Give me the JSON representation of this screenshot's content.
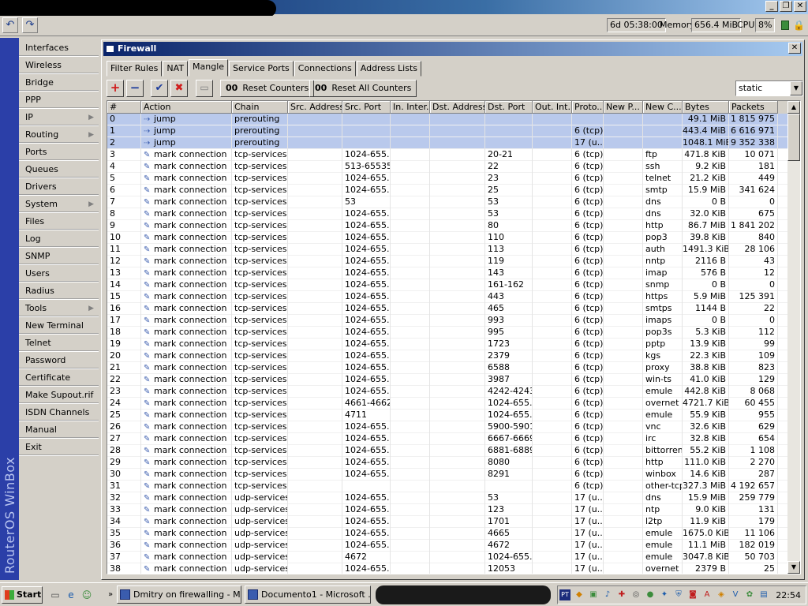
{
  "window": {
    "title": "",
    "controls": [
      "_",
      "❐",
      "✕"
    ]
  },
  "toolbar": {
    "uptime": "6d 05:38:00",
    "memory_label": "Memory:",
    "memory_value": "656.4 MiB",
    "cpu_label": "CPU:",
    "cpu_value": "8%"
  },
  "brand": "RouterOS WinBox",
  "sidebar": [
    {
      "label": "Interfaces"
    },
    {
      "label": "Wireless"
    },
    {
      "label": "Bridge"
    },
    {
      "label": "PPP"
    },
    {
      "label": "IP",
      "arrow": "▶"
    },
    {
      "label": "Routing",
      "arrow": "▶"
    },
    {
      "label": "Ports"
    },
    {
      "label": "Queues"
    },
    {
      "label": "Drivers"
    },
    {
      "label": "System",
      "arrow": "▶"
    },
    {
      "label": "Files"
    },
    {
      "label": "Log"
    },
    {
      "label": "SNMP"
    },
    {
      "label": "Users"
    },
    {
      "label": "Radius"
    },
    {
      "label": "Tools",
      "arrow": "▶"
    },
    {
      "label": "New Terminal"
    },
    {
      "label": "Telnet"
    },
    {
      "label": "Password"
    },
    {
      "label": "Certificate"
    },
    {
      "label": "Make Supout.rif"
    },
    {
      "label": "ISDN Channels"
    },
    {
      "label": "Manual"
    },
    {
      "label": "Exit"
    }
  ],
  "firewall": {
    "title": "Firewall",
    "tabs": [
      "Filter Rules",
      "NAT",
      "Mangle",
      "Service Ports",
      "Connections",
      "Address Lists"
    ],
    "active_tab": "Mangle",
    "buttons": {
      "add": "+",
      "remove": "−",
      "enable": "✔",
      "disable": "✖",
      "comment": "▭",
      "reset_counters": "Reset Counters",
      "reset_all_counters": "Reset All Counters",
      "counter_prefix": "00"
    },
    "filter_value": "static",
    "columns": [
      "#",
      "Action",
      "Chain",
      "Src. Address",
      "Src. Port",
      "In. Inter...",
      "Dst. Address",
      "Dst. Port",
      "Out. Int...",
      "Proto...",
      "New P...",
      "New C...",
      "Bytes",
      "Packets"
    ],
    "rows": [
      {
        "n": "0",
        "action": "jump",
        "icon": "jump",
        "chain": "prerouting",
        "src_port": "",
        "dst_port": "",
        "proto": "",
        "new_c": "",
        "bytes": "49.1 MiB",
        "packets": "1 815 975",
        "sel": true
      },
      {
        "n": "1",
        "action": "jump",
        "icon": "jump",
        "chain": "prerouting",
        "src_port": "",
        "dst_port": "",
        "proto": "6 (tcp)",
        "new_c": "",
        "bytes": "443.4 MiB",
        "packets": "6 616 971",
        "sel": true
      },
      {
        "n": "2",
        "action": "jump",
        "icon": "jump",
        "chain": "prerouting",
        "src_port": "",
        "dst_port": "",
        "proto": "17 (u...",
        "new_c": "",
        "bytes": "1048.1 MiB",
        "packets": "9 352 338",
        "sel": true
      },
      {
        "n": "3",
        "action": "mark connection",
        "icon": "mark",
        "chain": "tcp-services",
        "src_port": "1024-655...",
        "dst_port": "20-21",
        "proto": "6 (tcp)",
        "new_c": "ftp",
        "bytes": "471.8 KiB",
        "packets": "10 071"
      },
      {
        "n": "4",
        "action": "mark connection",
        "icon": "mark",
        "chain": "tcp-services",
        "src_port": "513-65535",
        "dst_port": "22",
        "proto": "6 (tcp)",
        "new_c": "ssh",
        "bytes": "9.2 KiB",
        "packets": "181"
      },
      {
        "n": "5",
        "action": "mark connection",
        "icon": "mark",
        "chain": "tcp-services",
        "src_port": "1024-655...",
        "dst_port": "23",
        "proto": "6 (tcp)",
        "new_c": "telnet",
        "bytes": "21.2 KiB",
        "packets": "449"
      },
      {
        "n": "6",
        "action": "mark connection",
        "icon": "mark",
        "chain": "tcp-services",
        "src_port": "1024-655...",
        "dst_port": "25",
        "proto": "6 (tcp)",
        "new_c": "smtp",
        "bytes": "15.9 MiB",
        "packets": "341 624"
      },
      {
        "n": "7",
        "action": "mark connection",
        "icon": "mark",
        "chain": "tcp-services",
        "src_port": "53",
        "dst_port": "53",
        "proto": "6 (tcp)",
        "new_c": "dns",
        "bytes": "0 B",
        "packets": "0"
      },
      {
        "n": "8",
        "action": "mark connection",
        "icon": "mark",
        "chain": "tcp-services",
        "src_port": "1024-655...",
        "dst_port": "53",
        "proto": "6 (tcp)",
        "new_c": "dns",
        "bytes": "32.0 KiB",
        "packets": "675"
      },
      {
        "n": "9",
        "action": "mark connection",
        "icon": "mark",
        "chain": "tcp-services",
        "src_port": "1024-655...",
        "dst_port": "80",
        "proto": "6 (tcp)",
        "new_c": "http",
        "bytes": "86.7 MiB",
        "packets": "1 841 202"
      },
      {
        "n": "10",
        "action": "mark connection",
        "icon": "mark",
        "chain": "tcp-services",
        "src_port": "1024-655...",
        "dst_port": "110",
        "proto": "6 (tcp)",
        "new_c": "pop3",
        "bytes": "39.8 KiB",
        "packets": "840"
      },
      {
        "n": "11",
        "action": "mark connection",
        "icon": "mark",
        "chain": "tcp-services",
        "src_port": "1024-655...",
        "dst_port": "113",
        "proto": "6 (tcp)",
        "new_c": "auth",
        "bytes": "1491.3 KiB",
        "packets": "28 106"
      },
      {
        "n": "12",
        "action": "mark connection",
        "icon": "mark",
        "chain": "tcp-services",
        "src_port": "1024-655...",
        "dst_port": "119",
        "proto": "6 (tcp)",
        "new_c": "nntp",
        "bytes": "2116 B",
        "packets": "43"
      },
      {
        "n": "13",
        "action": "mark connection",
        "icon": "mark",
        "chain": "tcp-services",
        "src_port": "1024-655...",
        "dst_port": "143",
        "proto": "6 (tcp)",
        "new_c": "imap",
        "bytes": "576 B",
        "packets": "12"
      },
      {
        "n": "14",
        "action": "mark connection",
        "icon": "mark",
        "chain": "tcp-services",
        "src_port": "1024-655...",
        "dst_port": "161-162",
        "proto": "6 (tcp)",
        "new_c": "snmp",
        "bytes": "0 B",
        "packets": "0"
      },
      {
        "n": "15",
        "action": "mark connection",
        "icon": "mark",
        "chain": "tcp-services",
        "src_port": "1024-655...",
        "dst_port": "443",
        "proto": "6 (tcp)",
        "new_c": "https",
        "bytes": "5.9 MiB",
        "packets": "125 391"
      },
      {
        "n": "16",
        "action": "mark connection",
        "icon": "mark",
        "chain": "tcp-services",
        "src_port": "1024-655...",
        "dst_port": "465",
        "proto": "6 (tcp)",
        "new_c": "smtps",
        "bytes": "1144 B",
        "packets": "22"
      },
      {
        "n": "17",
        "action": "mark connection",
        "icon": "mark",
        "chain": "tcp-services",
        "src_port": "1024-655...",
        "dst_port": "993",
        "proto": "6 (tcp)",
        "new_c": "imaps",
        "bytes": "0 B",
        "packets": "0"
      },
      {
        "n": "18",
        "action": "mark connection",
        "icon": "mark",
        "chain": "tcp-services",
        "src_port": "1024-655...",
        "dst_port": "995",
        "proto": "6 (tcp)",
        "new_c": "pop3s",
        "bytes": "5.3 KiB",
        "packets": "112"
      },
      {
        "n": "19",
        "action": "mark connection",
        "icon": "mark",
        "chain": "tcp-services",
        "src_port": "1024-655...",
        "dst_port": "1723",
        "proto": "6 (tcp)",
        "new_c": "pptp",
        "bytes": "13.9 KiB",
        "packets": "99"
      },
      {
        "n": "20",
        "action": "mark connection",
        "icon": "mark",
        "chain": "tcp-services",
        "src_port": "1024-655...",
        "dst_port": "2379",
        "proto": "6 (tcp)",
        "new_c": "kgs",
        "bytes": "22.3 KiB",
        "packets": "109"
      },
      {
        "n": "21",
        "action": "mark connection",
        "icon": "mark",
        "chain": "tcp-services",
        "src_port": "1024-655...",
        "dst_port": "6588",
        "proto": "6 (tcp)",
        "new_c": "proxy",
        "bytes": "38.8 KiB",
        "packets": "823"
      },
      {
        "n": "22",
        "action": "mark connection",
        "icon": "mark",
        "chain": "tcp-services",
        "src_port": "1024-655...",
        "dst_port": "3987",
        "proto": "6 (tcp)",
        "new_c": "win-ts",
        "bytes": "41.0 KiB",
        "packets": "129"
      },
      {
        "n": "23",
        "action": "mark connection",
        "icon": "mark",
        "chain": "tcp-services",
        "src_port": "1024-655...",
        "dst_port": "4242-4243",
        "proto": "6 (tcp)",
        "new_c": "emule",
        "bytes": "442.8 KiB",
        "packets": "8 068"
      },
      {
        "n": "24",
        "action": "mark connection",
        "icon": "mark",
        "chain": "tcp-services",
        "src_port": "4661-4662",
        "dst_port": "1024-655...",
        "proto": "6 (tcp)",
        "new_c": "overnet",
        "bytes": "4721.7 KiB",
        "packets": "60 455"
      },
      {
        "n": "25",
        "action": "mark connection",
        "icon": "mark",
        "chain": "tcp-services",
        "src_port": "4711",
        "dst_port": "1024-655...",
        "proto": "6 (tcp)",
        "new_c": "emule",
        "bytes": "55.9 KiB",
        "packets": "955"
      },
      {
        "n": "26",
        "action": "mark connection",
        "icon": "mark",
        "chain": "tcp-services",
        "src_port": "1024-655...",
        "dst_port": "5900-5901",
        "proto": "6 (tcp)",
        "new_c": "vnc",
        "bytes": "32.6 KiB",
        "packets": "629"
      },
      {
        "n": "27",
        "action": "mark connection",
        "icon": "mark",
        "chain": "tcp-services",
        "src_port": "1024-655...",
        "dst_port": "6667-6669",
        "proto": "6 (tcp)",
        "new_c": "irc",
        "bytes": "32.8 KiB",
        "packets": "654"
      },
      {
        "n": "28",
        "action": "mark connection",
        "icon": "mark",
        "chain": "tcp-services",
        "src_port": "1024-655...",
        "dst_port": "6881-6889",
        "proto": "6 (tcp)",
        "new_c": "bittorrent",
        "bytes": "55.2 KiB",
        "packets": "1 108"
      },
      {
        "n": "29",
        "action": "mark connection",
        "icon": "mark",
        "chain": "tcp-services",
        "src_port": "1024-655...",
        "dst_port": "8080",
        "proto": "6 (tcp)",
        "new_c": "http",
        "bytes": "111.0 KiB",
        "packets": "2 270"
      },
      {
        "n": "30",
        "action": "mark connection",
        "icon": "mark",
        "chain": "tcp-services",
        "src_port": "1024-655...",
        "dst_port": "8291",
        "proto": "6 (tcp)",
        "new_c": "winbox",
        "bytes": "14.6 KiB",
        "packets": "287"
      },
      {
        "n": "31",
        "action": "mark connection",
        "icon": "mark",
        "chain": "tcp-services",
        "src_port": "",
        "dst_port": "",
        "proto": "6 (tcp)",
        "new_c": "other-tcp",
        "bytes": "327.3 MiB",
        "packets": "4 192 657"
      },
      {
        "n": "32",
        "action": "mark connection",
        "icon": "mark",
        "chain": "udp-services",
        "src_port": "1024-655...",
        "dst_port": "53",
        "proto": "17 (u...",
        "new_c": "dns",
        "bytes": "15.9 MiB",
        "packets": "259 779"
      },
      {
        "n": "33",
        "action": "mark connection",
        "icon": "mark",
        "chain": "udp-services",
        "src_port": "1024-655...",
        "dst_port": "123",
        "proto": "17 (u...",
        "new_c": "ntp",
        "bytes": "9.0 KiB",
        "packets": "131"
      },
      {
        "n": "34",
        "action": "mark connection",
        "icon": "mark",
        "chain": "udp-services",
        "src_port": "1024-655...",
        "dst_port": "1701",
        "proto": "17 (u...",
        "new_c": "l2tp",
        "bytes": "11.9 KiB",
        "packets": "179"
      },
      {
        "n": "35",
        "action": "mark connection",
        "icon": "mark",
        "chain": "udp-services",
        "src_port": "1024-655...",
        "dst_port": "4665",
        "proto": "17 (u...",
        "new_c": "emule",
        "bytes": "1675.0 KiB",
        "packets": "11 106"
      },
      {
        "n": "36",
        "action": "mark connection",
        "icon": "mark",
        "chain": "udp-services",
        "src_port": "1024-655...",
        "dst_port": "4672",
        "proto": "17 (u...",
        "new_c": "emule",
        "bytes": "11.1 MiB",
        "packets": "182 019"
      },
      {
        "n": "37",
        "action": "mark connection",
        "icon": "mark",
        "chain": "udp-services",
        "src_port": "4672",
        "dst_port": "1024-655...",
        "proto": "17 (u...",
        "new_c": "emule",
        "bytes": "3047.8 KiB",
        "packets": "50 703"
      },
      {
        "n": "38",
        "action": "mark connection",
        "icon": "mark",
        "chain": "udp-services",
        "src_port": "1024-655...",
        "dst_port": "12053",
        "proto": "17 (u...",
        "new_c": "overnet",
        "bytes": "2379 B",
        "packets": "25"
      }
    ]
  },
  "taskbar": {
    "start_label": "Start",
    "tasks": [
      "Dmitry on firewalling - Mi...",
      "Documento1 - Microsoft ..."
    ],
    "clock": "22:54",
    "tray_label": "PT"
  },
  "colors": {
    "selection": "#b9c9ec",
    "title_active": "#0a246a",
    "brand": "#2b3fa8"
  }
}
